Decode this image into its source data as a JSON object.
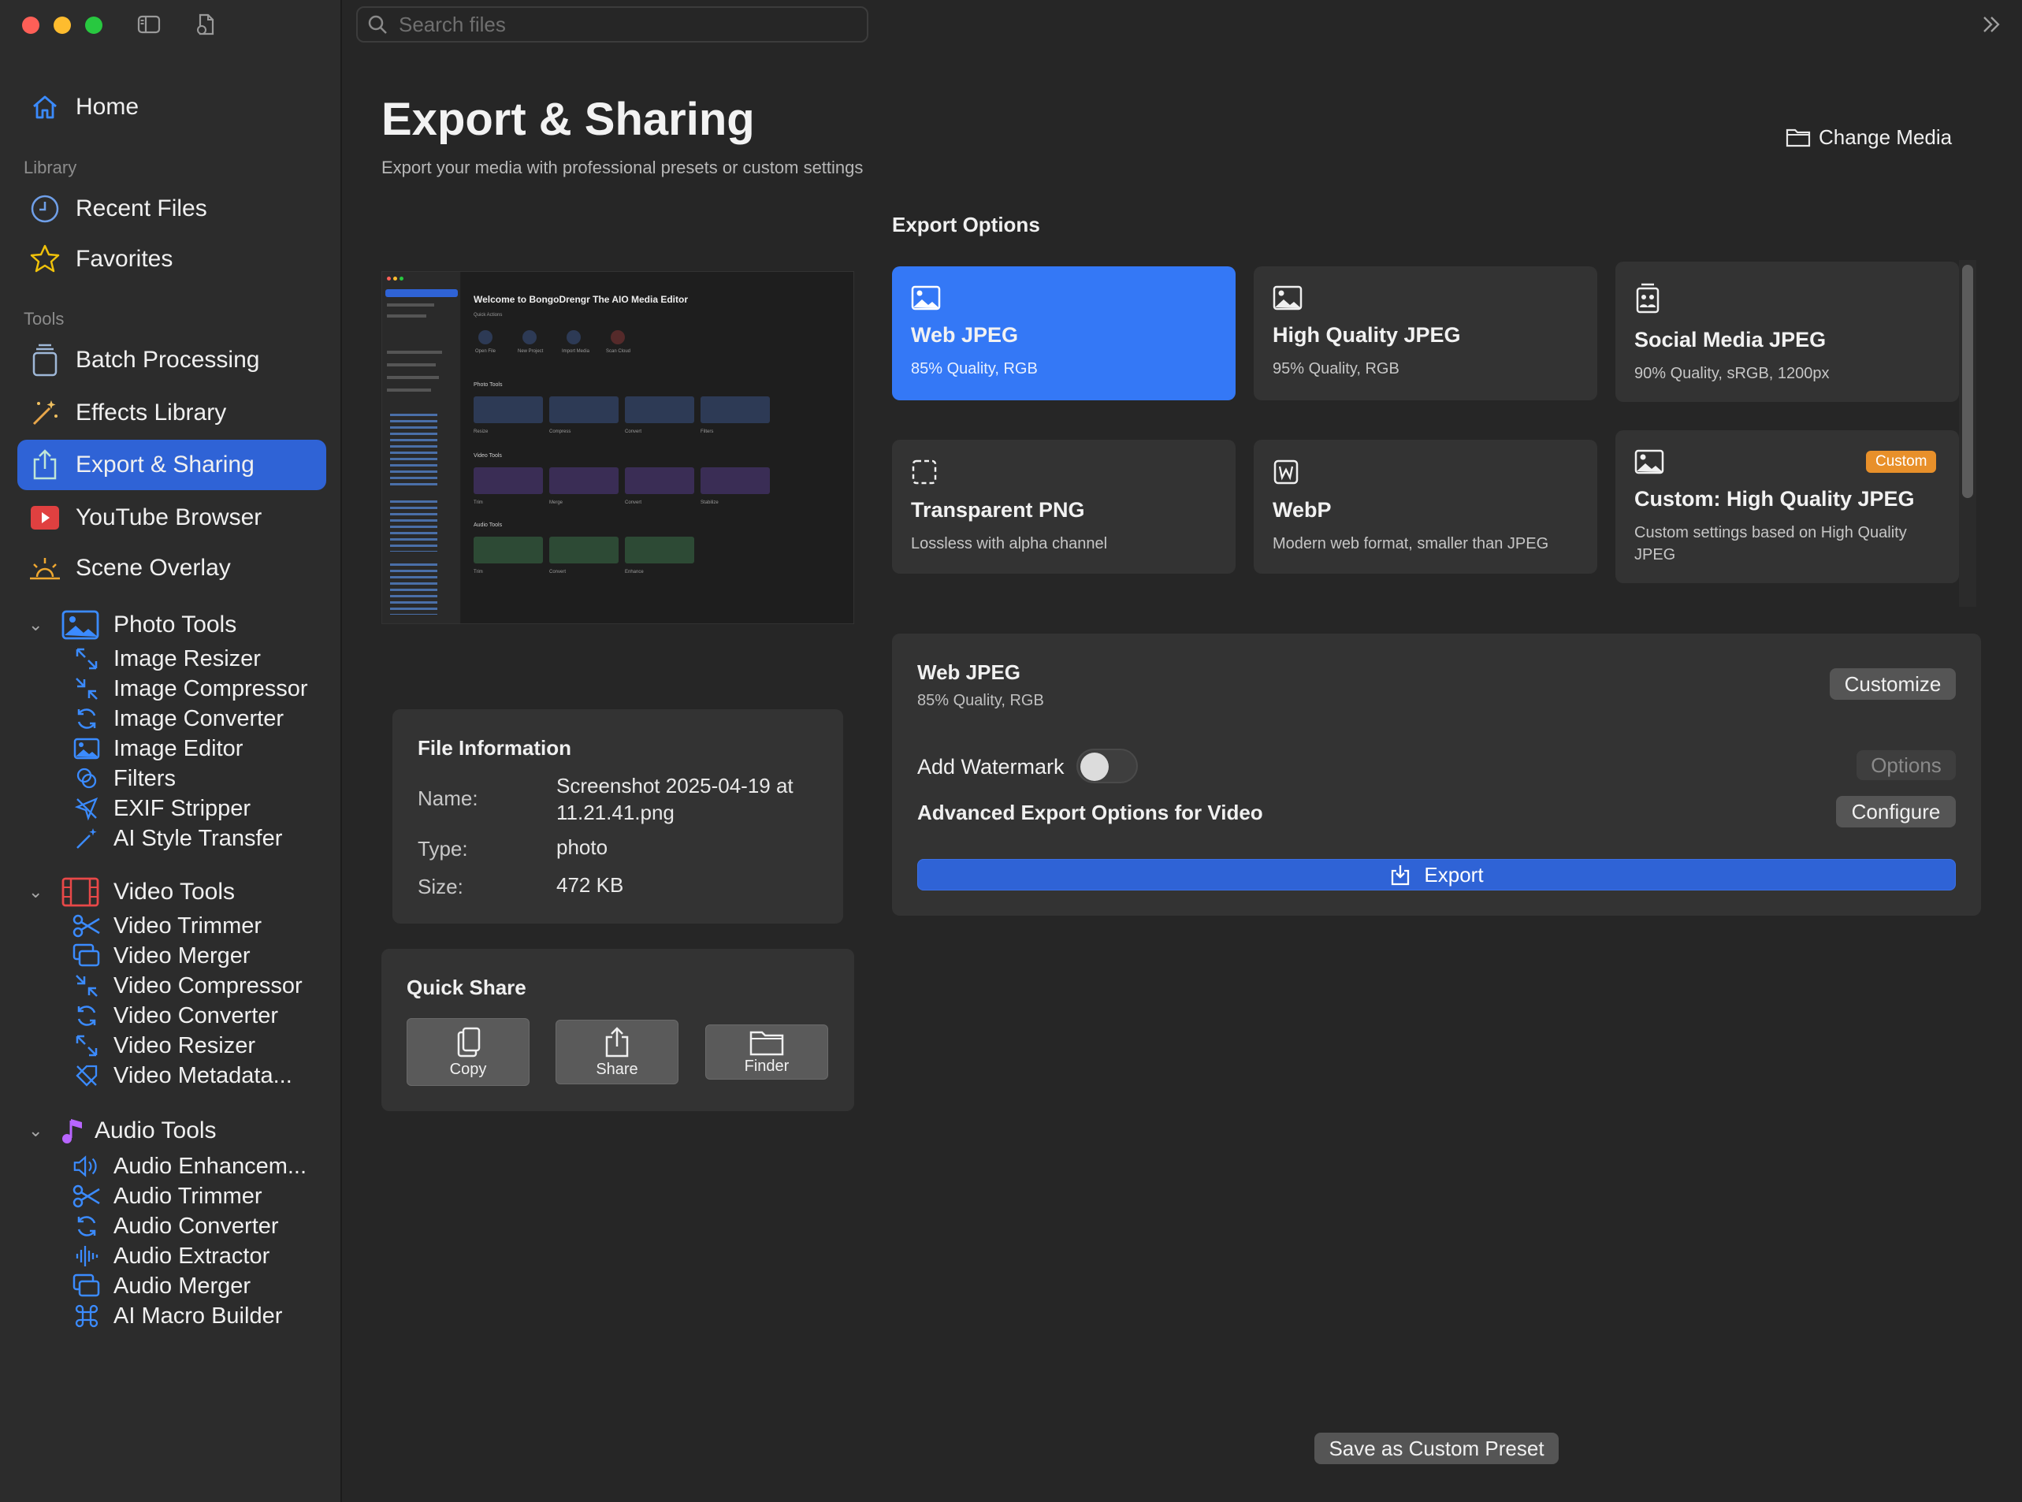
{
  "window": {
    "traffic_lights": {
      "close": "#fe5f57",
      "minimize": "#febc2e",
      "maximize": "#28c840"
    }
  },
  "toolbar": {
    "search_placeholder": "Search files",
    "sidebar_toggle_icon": "sidebar-icon",
    "new_file_icon": "doc-gear-icon",
    "expand_icon": "double-chevron-right-icon"
  },
  "sidebar": {
    "home": "Home",
    "library_header": "Library",
    "recent_files": "Recent Files",
    "favorites": "Favorites",
    "tools_header": "Tools",
    "batch_processing": "Batch Processing",
    "effects_library": "Effects Library",
    "export_sharing": "Export & Sharing",
    "youtube_browser": "YouTube Browser",
    "scene_overlay": "Scene Overlay",
    "photo_tools": {
      "label": "Photo Tools",
      "items": [
        "Image Resizer",
        "Image Compressor",
        "Image Converter",
        "Image Editor",
        "Filters",
        "EXIF Stripper",
        "AI Style Transfer"
      ]
    },
    "video_tools": {
      "label": "Video Tools",
      "items": [
        "Video Trimmer",
        "Video Merger",
        "Video Compressor",
        "Video Converter",
        "Video Resizer",
        "Video Metadata..."
      ]
    },
    "audio_tools": {
      "label": "Audio Tools",
      "items": [
        "Audio Enhancem...",
        "Audio Trimmer",
        "Audio Converter",
        "Audio Extractor",
        "Audio Merger",
        "AI Macro Builder"
      ]
    }
  },
  "page": {
    "title": "Export & Sharing",
    "subtitle": "Export your media with professional presets or custom settings",
    "change_media": "Change Media"
  },
  "preview": {
    "heading": "Welcome to BongoDrengr The AIO Media Editor",
    "quick_actions": "Quick Actions",
    "actions": [
      "Open File",
      "New Project",
      "Import Media",
      "Scan Cloud"
    ],
    "sections": [
      {
        "title": "Photo Tools",
        "tiles": [
          "Resize",
          "Compress",
          "Convert",
          "Filters"
        ]
      },
      {
        "title": "Video Tools",
        "tiles": [
          "Trim",
          "Merge",
          "Convert",
          "Stabilize"
        ]
      },
      {
        "title": "Audio Tools",
        "tiles": [
          "Trim",
          "Convert",
          "Enhance"
        ]
      }
    ]
  },
  "file_info": {
    "heading": "File Information",
    "name_label": "Name:",
    "name_value": "Screenshot 2025-04-19 at 11.21.41.png",
    "type_label": "Type:",
    "type_value": "photo",
    "size_label": "Size:",
    "size_value": "472 KB"
  },
  "quick_share": {
    "heading": "Quick Share",
    "copy": "Copy",
    "share": "Share",
    "finder": "Finder"
  },
  "export_options": {
    "heading": "Export Options",
    "presets": [
      {
        "name": "Web JPEG",
        "desc": "85% Quality, RGB",
        "icon": "photo-icon",
        "selected": true
      },
      {
        "name": "High Quality JPEG",
        "desc": "95% Quality, RGB",
        "icon": "photo-icon"
      },
      {
        "name": "Social Media JPEG",
        "desc": "90% Quality, sRGB, 1200px",
        "icon": "people-icon"
      },
      {
        "name": "Transparent PNG",
        "desc": "Lossless with alpha channel",
        "icon": "dashed-square-icon"
      },
      {
        "name": "WebP",
        "desc": "Modern web format, smaller than JPEG",
        "icon": "w-square-icon"
      },
      {
        "name": "Custom: High Quality JPEG",
        "desc": "Custom settings based on High Quality JPEG",
        "icon": "photo-icon",
        "badge": "Custom"
      }
    ],
    "accent": "#3478f6",
    "badge_color": "#e8902a"
  },
  "settings": {
    "selected_name": "Web JPEG",
    "selected_desc": "85% Quality, RGB",
    "customize": "Customize",
    "watermark_label": "Add Watermark",
    "watermark_on": false,
    "options": "Options",
    "advanced_label": "Advanced Export Options for Video",
    "configure": "Configure",
    "export": "Export"
  },
  "footer": {
    "save_preset": "Save as Custom Preset"
  }
}
